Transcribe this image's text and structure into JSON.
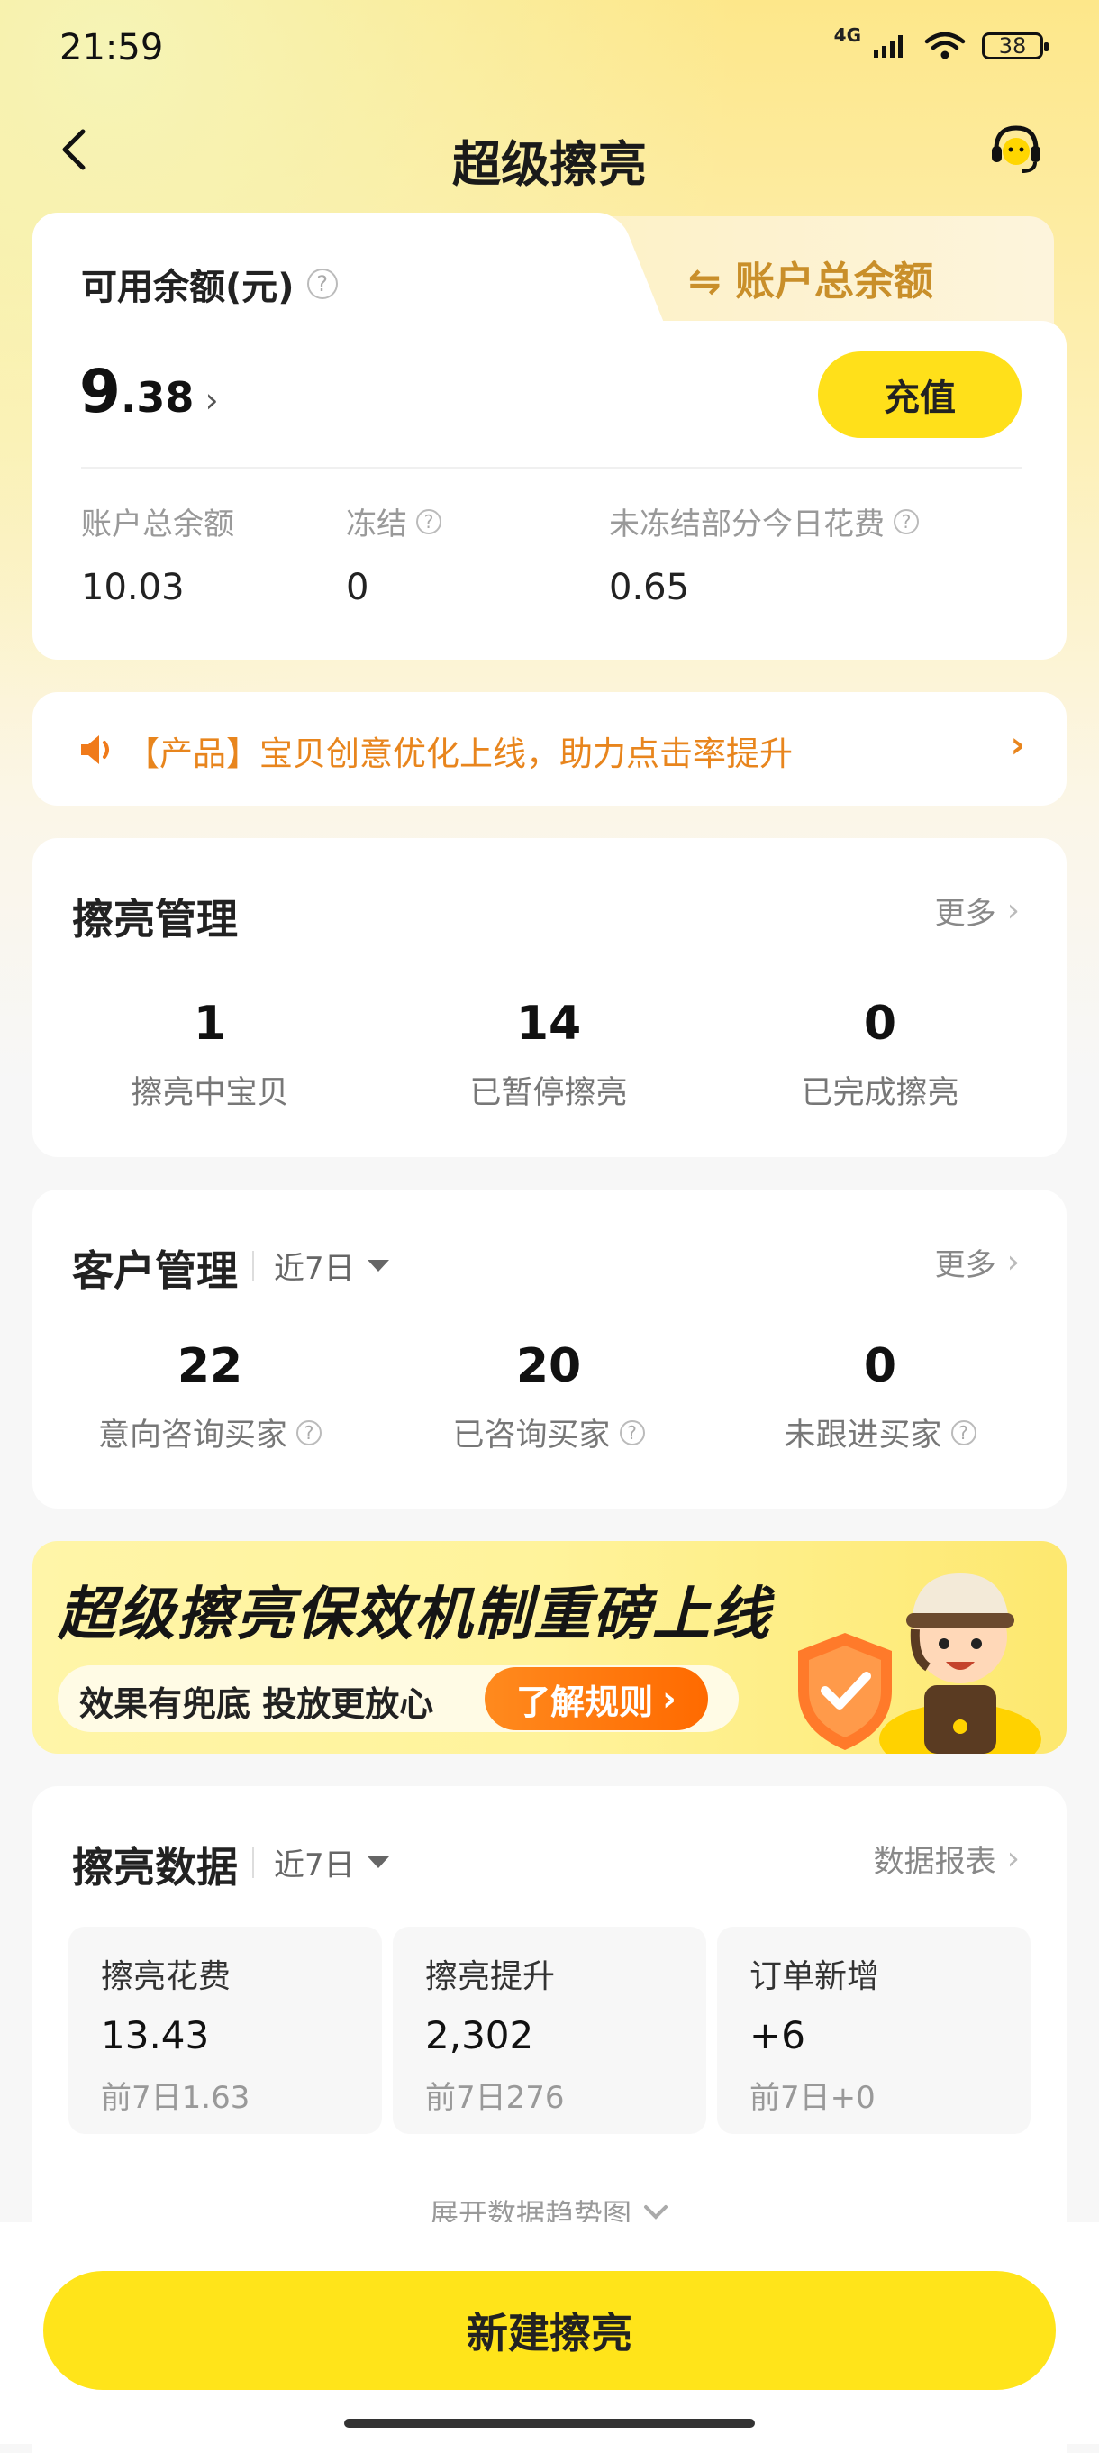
{
  "status_bar": {
    "time": "21:59",
    "network": "4G",
    "battery": "38"
  },
  "nav": {
    "title": "超级擦亮"
  },
  "balance": {
    "label": "可用余额(元)",
    "toggle_label": "⇋ 账户总余额",
    "amount_int": "9",
    "amount_dec": ".38",
    "recharge_label": "充值",
    "stats": [
      {
        "label": "账户总余额",
        "value": "10.03"
      },
      {
        "label": "冻结",
        "value": "0"
      },
      {
        "label": "未冻结部分今日花费",
        "value": "0.65"
      }
    ]
  },
  "notice": {
    "text": "【产品】宝贝创意优化上线，助力点击率提升"
  },
  "manage": {
    "title": "擦亮管理",
    "more": "更多",
    "metrics": [
      {
        "value": "1",
        "label": "擦亮中宝贝"
      },
      {
        "value": "14",
        "label": "已暂停擦亮"
      },
      {
        "value": "0",
        "label": "已完成擦亮"
      }
    ]
  },
  "customer": {
    "title": "客户管理",
    "period": "近7日",
    "more": "更多",
    "metrics": [
      {
        "value": "22",
        "label": "意向咨询买家"
      },
      {
        "value": "20",
        "label": "已咨询买家"
      },
      {
        "value": "0",
        "label": "未跟进买家"
      }
    ]
  },
  "banner": {
    "title": "超级擦亮保效机制重磅上线",
    "subtitle": "效果有兜底  投放更放心",
    "button": "了解规则"
  },
  "data_section": {
    "title": "擦亮数据",
    "period": "近7日",
    "report": "数据报表",
    "tiles": [
      {
        "title": "擦亮花费",
        "value": "13.43",
        "prev": "前7日1.63"
      },
      {
        "title": "擦亮提升",
        "value": "2,302",
        "prev": "前7日276"
      },
      {
        "title": "订单新增",
        "value": "+6",
        "prev": "前7日+0"
      }
    ],
    "expand": "展开数据趋势图"
  },
  "bottom": {
    "new_button": "新建擦亮"
  },
  "colors": {
    "accent_yellow": "#ffe01a",
    "notice_orange": "#e8851d",
    "banner_button": "#ff7a0f"
  }
}
